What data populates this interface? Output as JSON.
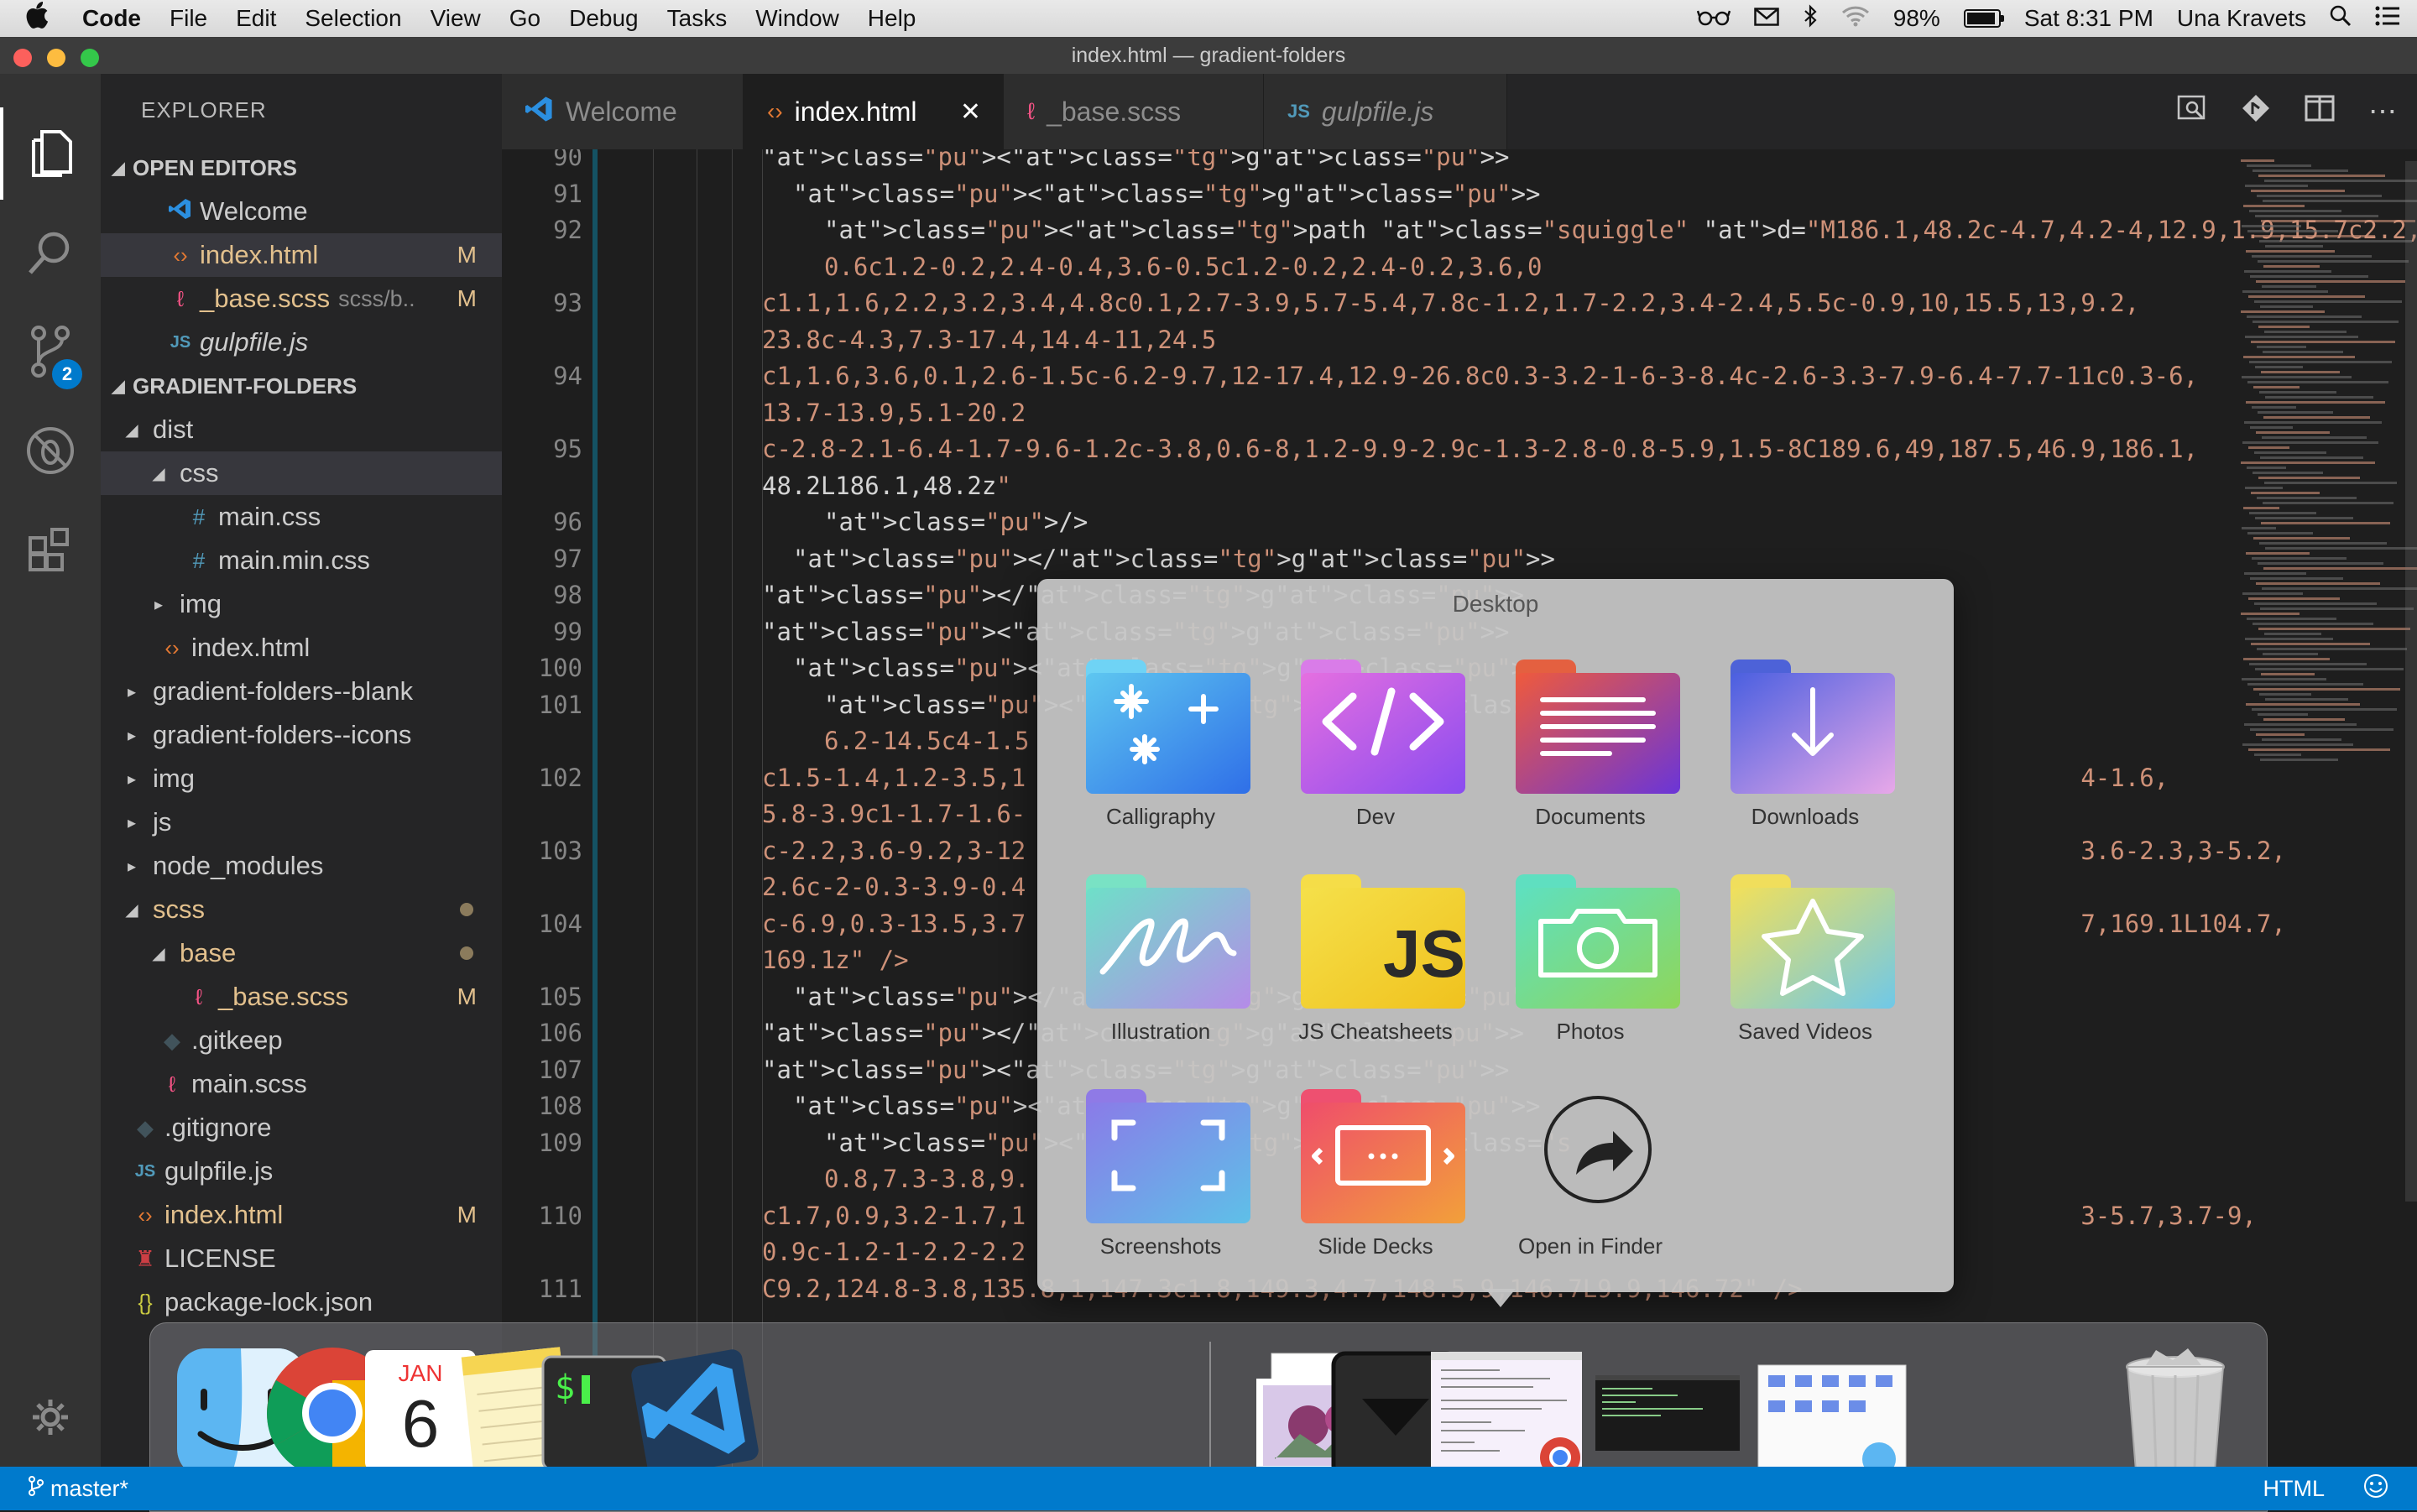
{
  "menubar": {
    "app": "Code",
    "items": [
      "File",
      "Edit",
      "Selection",
      "View",
      "Go",
      "Debug",
      "Tasks",
      "Window",
      "Help"
    ],
    "battery_level": 0.98,
    "battery_text": "98%",
    "clock": "Sat 8:31 PM",
    "user": "Una Kravets"
  },
  "window": {
    "title": "index.html — gradient-folders"
  },
  "activity": {
    "scm_badge": "2"
  },
  "sidebar": {
    "title": "EXPLORER",
    "open_editors_header": "OPEN EDITORS",
    "open_editors": [
      {
        "name": "Welcome",
        "icon": "vscode-icon",
        "status": ""
      },
      {
        "name": "index.html",
        "icon": "html-icon",
        "status": "M"
      },
      {
        "name": "_base.scss",
        "icon": "sass-icon",
        "status": "M",
        "path": "scss/b.."
      },
      {
        "name": "gulpfile.js",
        "icon": "js-icon",
        "status": ""
      }
    ],
    "project_header": "GRADIENT-FOLDERS",
    "tree": [
      {
        "name": "dist",
        "depth": 1,
        "type": "folder-open",
        "status": ""
      },
      {
        "name": "css",
        "depth": 2,
        "type": "folder-open",
        "status": ""
      },
      {
        "name": "main.css",
        "depth": 3,
        "type": "css",
        "status": ""
      },
      {
        "name": "main.min.css",
        "depth": 3,
        "type": "css",
        "status": ""
      },
      {
        "name": "img",
        "depth": 2,
        "type": "folder",
        "status": ""
      },
      {
        "name": "index.html",
        "depth": 2,
        "type": "html",
        "status": ""
      },
      {
        "name": "gradient-folders--blank",
        "depth": 1,
        "type": "folder",
        "status": ""
      },
      {
        "name": "gradient-folders--icons",
        "depth": 1,
        "type": "folder",
        "status": ""
      },
      {
        "name": "img",
        "depth": 1,
        "type": "folder",
        "status": ""
      },
      {
        "name": "js",
        "depth": 1,
        "type": "folder",
        "status": ""
      },
      {
        "name": "node_modules",
        "depth": 1,
        "type": "folder",
        "status": ""
      },
      {
        "name": "scss",
        "depth": 1,
        "type": "folder-open",
        "status": "dot"
      },
      {
        "name": "base",
        "depth": 2,
        "type": "folder-open",
        "status": "dot"
      },
      {
        "name": "_base.scss",
        "depth": 3,
        "type": "sass",
        "status": "M"
      },
      {
        "name": ".gitkeep",
        "depth": 2,
        "type": "git",
        "status": ""
      },
      {
        "name": "main.scss",
        "depth": 2,
        "type": "sass",
        "status": ""
      },
      {
        "name": ".gitignore",
        "depth": 1,
        "type": "git",
        "status": ""
      },
      {
        "name": "gulpfile.js",
        "depth": 1,
        "type": "js",
        "status": ""
      },
      {
        "name": "index.html",
        "depth": 1,
        "type": "html",
        "status": "M"
      },
      {
        "name": "LICENSE",
        "depth": 1,
        "type": "license",
        "status": ""
      },
      {
        "name": "package-lock.json",
        "depth": 1,
        "type": "json",
        "status": ""
      }
    ]
  },
  "tabs": [
    {
      "label": "Welcome",
      "icon": "vscode-icon",
      "active": false
    },
    {
      "label": "index.html",
      "icon": "html-icon",
      "active": true
    },
    {
      "label": "_base.scss",
      "icon": "sass-icon",
      "active": false
    },
    {
      "label": "gulpfile.js",
      "icon": "js-icon",
      "active": false
    }
  ],
  "editor": {
    "lines": [
      {
        "n": "90",
        "t": "<g>",
        "indent": 0
      },
      {
        "n": "91",
        "t": "<g>",
        "indent": 1
      },
      {
        "n": "92",
        "t": "<path class=\"squiggle\" d=\"M186.1,48.2c-4.7,4.2-4,12.9,1.9,15.7c2.2,1.1,4.8,0.9,7.1,",
        "indent": 2
      },
      {
        "n": "",
        "t": "0.6c1.2-0.2,2.4-0.4,3.6-0.5c1.2-0.2,2.4-0.2,3.6,0",
        "indent": 2
      },
      {
        "n": "93",
        "t": "c1.1,1.6,2.2,3.2,3.4,4.8c0.1,2.7-3.9,5.7-5.4,7.8c-1.2,1.7-2.2,3.4-2.4,5.5c-0.9,10,15.5,13,9.2,",
        "indent": 0
      },
      {
        "n": "",
        "t": "23.8c-4.3,7.3-17.4,14.4-11,24.5",
        "indent": 0
      },
      {
        "n": "94",
        "t": "c1,1.6,3.6,0.1,2.6-1.5c-6.2-9.7,12-17.4,12.9-26.8c0.3-3.2-1-6-3-8.4c-2.6-3.3-7.9-6.4-7.7-11c0.3-6,",
        "indent": 0
      },
      {
        "n": "",
        "t": "13.7-13.9,5.1-20.2",
        "indent": 0
      },
      {
        "n": "95",
        "t": "c-2.8-2.1-6.4-1.7-9.6-1.2c-3.8,0.6-8,1.2-9.9-2.9c-1.3-2.8-0.8-5.9,1.5-8C189.6,49,187.5,46.9,186.1,",
        "indent": 0
      },
      {
        "n": "",
        "t": "48.2L186.1,48.2z\"",
        "indent": 0
      },
      {
        "n": "96",
        "t": "/>",
        "indent": 2
      },
      {
        "n": "97",
        "t": "</g>",
        "indent": 1
      },
      {
        "n": "98",
        "t": "</g>",
        "indent": 0
      },
      {
        "n": "99",
        "t": "<g>",
        "indent": 0
      },
      {
        "n": "100",
        "t": "<g>",
        "indent": 1
      },
      {
        "n": "101",
        "t": "<path class=\"s                                                                        2-12.2,",
        "indent": 2
      },
      {
        "n": "",
        "t": "6.2-14.5c4-1.5",
        "indent": 2
      },
      {
        "n": "102",
        "t": "c1.5-1.4,1.2-3.5,1                                                                        4-1.6,",
        "indent": 0
      },
      {
        "n": "",
        "t": "5.8-3.9c1-1.7-1.6-",
        "indent": 0
      },
      {
        "n": "103",
        "t": "c-2.2,3.6-9.2,3-12                                                                        3.6-2.3,3-5.2,",
        "indent": 0
      },
      {
        "n": "",
        "t": "2.6c-2-0.3-3.9-0.4",
        "indent": 0
      },
      {
        "n": "104",
        "t": "c-6.9,0.3-13.5,3.7                                                                        7,169.1L104.7,",
        "indent": 0
      },
      {
        "n": "",
        "t": "169.1z\" />",
        "indent": 0
      },
      {
        "n": "105",
        "t": "</g>",
        "indent": 1
      },
      {
        "n": "106",
        "t": "</g>",
        "indent": 0
      },
      {
        "n": "107",
        "t": "<g>",
        "indent": 0
      },
      {
        "n": "108",
        "t": "<g>",
        "indent": 1
      },
      {
        "n": "109",
        "t": "<path class=\"s                                                                        5.7,11.7,7.5c4.6,",
        "indent": 2
      },
      {
        "n": "",
        "t": "0.8,7.3-3.8,9.",
        "indent": 2
      },
      {
        "n": "110",
        "t": "c1.7,0.9,3.2-1.7,1                                                                        3-5.7,3.7-9,",
        "indent": 0
      },
      {
        "n": "",
        "t": "0.9c-1.2-1-2.2-2.2",
        "indent": 0
      },
      {
        "n": "111",
        "t": "C9.2,124.8-3.8,135.8,1,147.3c1.8,149.3,4.7,148.5,9,146.7L9.9,146.72\" />",
        "indent": 0
      }
    ]
  },
  "stack": {
    "title": "Desktop",
    "items": [
      {
        "label": "Calligraphy",
        "icon": "sparkle-icon",
        "c1": "#5ec7f0",
        "c2": "#2f6fe8",
        "tab": "#6fd3f5"
      },
      {
        "label": "Dev",
        "icon": "code-icon",
        "c1": "#e56fe0",
        "c2": "#8a4cf0",
        "tab": "#d97ce8"
      },
      {
        "label": "Documents",
        "icon": "document-lines-icon",
        "c1": "#ef5a3c",
        "c2": "#6a35d8",
        "tab": "#e46040"
      },
      {
        "label": "Downloads",
        "icon": "download-arrow-icon",
        "c1": "#4a5fe0",
        "c2": "#e8a8e8",
        "tab": "#4d62d8"
      },
      {
        "label": "Illustration",
        "icon": "scribble-icon",
        "c1": "#6ee0c8",
        "c2": "#b58be8",
        "tab": "#79e2c4"
      },
      {
        "label": "JS Cheatsheets",
        "icon": "js-logo-icon",
        "c1": "#f5e04a",
        "c2": "#f0c21e",
        "tab": "#f5dd48"
      },
      {
        "label": "Photos",
        "icon": "camera-icon",
        "c1": "#5ee0c0",
        "c2": "#8fd65a",
        "tab": "#5fdfc0"
      },
      {
        "label": "Saved Videos",
        "icon": "star-icon",
        "c1": "#f2e05a",
        "c2": "#6fc8e8",
        "tab": "#f0de5c"
      },
      {
        "label": "Screenshots",
        "icon": "screenshot-corners-icon",
        "c1": "#8a7be8",
        "c2": "#5ec0e8",
        "tab": "#8f7ae6"
      },
      {
        "label": "Slide Decks",
        "icon": "slides-icon",
        "c1": "#ef4d6b",
        "c2": "#f2a03a",
        "tab": "#ee5070"
      },
      {
        "label": "Open in Finder",
        "icon": "open-arrow-icon"
      }
    ]
  },
  "dock": {
    "calendar_month": "JAN",
    "calendar_day": "6",
    "terminal_prompt": "$"
  },
  "status": {
    "branch": "master*",
    "language": "HTML"
  }
}
